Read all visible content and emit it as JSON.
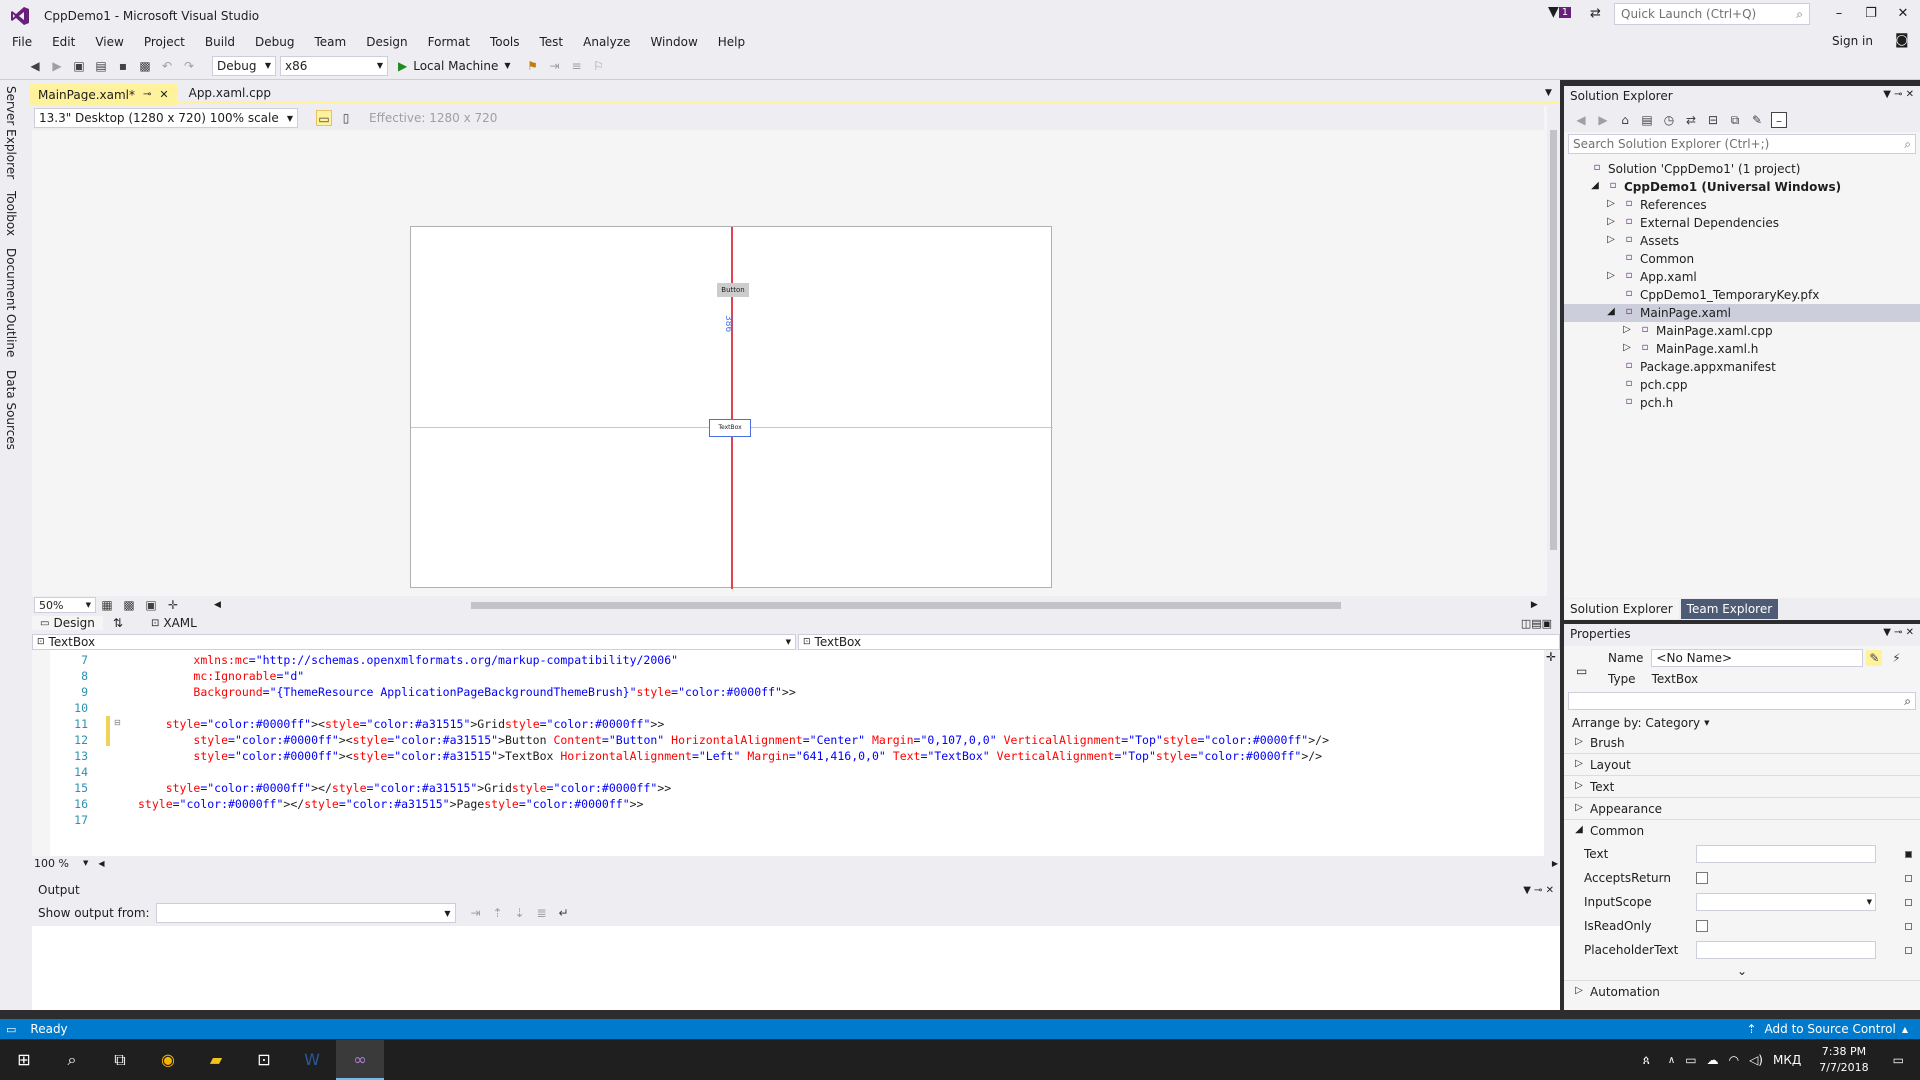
{
  "window": {
    "title": "CppDemo1 - Microsoft Visual Studio",
    "quick_launch_placeholder": "Quick Launch (Ctrl+Q)",
    "notification_count": "1",
    "sign_in": "Sign in"
  },
  "menu": [
    "File",
    "Edit",
    "View",
    "Project",
    "Build",
    "Debug",
    "Team",
    "Design",
    "Format",
    "Tools",
    "Test",
    "Analyze",
    "Window",
    "Help"
  ],
  "toolbar": {
    "config": "Debug",
    "platform": "x86",
    "run_target": "Local Machine"
  },
  "left_tabs": [
    "Server Explorer",
    "Toolbox",
    "Document Outline",
    "Data Sources"
  ],
  "doc_tabs": [
    {
      "label": "MainPage.xaml*",
      "active": true
    },
    {
      "label": "App.xaml.cpp",
      "active": false
    }
  ],
  "designer": {
    "device": "13.3\" Desktop (1280 x 720) 100% scale",
    "effective": "Effective: 1280 x 720",
    "zoom": "50%",
    "button_label": "Button",
    "textbox_label": "TextBox",
    "margin_label": "386",
    "design_tab": "Design",
    "xaml_tab": "XAML",
    "left_element": "TextBox",
    "right_element": "TextBox"
  },
  "code": {
    "zoom": "100 %",
    "lines": [
      {
        "num": "7",
        "text": "        xmlns:mc=\"http://schemas.openxmlformats.org/markup-compatibility/2006\""
      },
      {
        "num": "8",
        "text": "        mc:Ignorable=\"d\""
      },
      {
        "num": "9",
        "text": "        Background=\"{ThemeResource ApplicationPageBackgroundThemeBrush}\">"
      },
      {
        "num": "10",
        "text": ""
      },
      {
        "num": "11",
        "text": "    <Grid>"
      },
      {
        "num": "12",
        "text": "        <Button Content=\"Button\" HorizontalAlignment=\"Center\" Margin=\"0,107,0,0\" VerticalAlignment=\"Top\"/>"
      },
      {
        "num": "13",
        "text": "        <TextBox HorizontalAlignment=\"Left\" Margin=\"641,416,0,0\" Text=\"TextBox\" VerticalAlignment=\"Top\"/>"
      },
      {
        "num": "14",
        "text": ""
      },
      {
        "num": "15",
        "text": "    </Grid>"
      },
      {
        "num": "16",
        "text": "</Page>"
      },
      {
        "num": "17",
        "text": ""
      }
    ]
  },
  "output": {
    "title": "Output",
    "show_from": "Show output from:"
  },
  "solution_explorer": {
    "title": "Solution Explorer",
    "search_placeholder": "Search Solution Explorer (Ctrl+;)",
    "items": [
      {
        "label": "Solution 'CppDemo1' (1 project)",
        "depth": 0,
        "bold": false,
        "expander": "",
        "selected": false
      },
      {
        "label": "CppDemo1 (Universal Windows)",
        "depth": 1,
        "bold": true,
        "expander": "◢",
        "selected": false
      },
      {
        "label": "References",
        "depth": 2,
        "bold": false,
        "expander": "▷",
        "selected": false
      },
      {
        "label": "External Dependencies",
        "depth": 2,
        "bold": false,
        "expander": "▷",
        "selected": false
      },
      {
        "label": "Assets",
        "depth": 2,
        "bold": false,
        "expander": "▷",
        "selected": false
      },
      {
        "label": "Common",
        "depth": 2,
        "bold": false,
        "expander": "",
        "selected": false
      },
      {
        "label": "App.xaml",
        "depth": 2,
        "bold": false,
        "expander": "▷",
        "selected": false
      },
      {
        "label": "CppDemo1_TemporaryKey.pfx",
        "depth": 2,
        "bold": false,
        "expander": "",
        "selected": false
      },
      {
        "label": "MainPage.xaml",
        "depth": 2,
        "bold": false,
        "expander": "◢",
        "selected": true
      },
      {
        "label": "MainPage.xaml.cpp",
        "depth": 3,
        "bold": false,
        "expander": "▷",
        "selected": false
      },
      {
        "label": "MainPage.xaml.h",
        "depth": 3,
        "bold": false,
        "expander": "▷",
        "selected": false
      },
      {
        "label": "Package.appxmanifest",
        "depth": 2,
        "bold": false,
        "expander": "",
        "selected": false
      },
      {
        "label": "pch.cpp",
        "depth": 2,
        "bold": false,
        "expander": "",
        "selected": false
      },
      {
        "label": "pch.h",
        "depth": 2,
        "bold": false,
        "expander": "",
        "selected": false
      }
    ],
    "tab_solution": "Solution Explorer",
    "tab_team": "Team Explorer"
  },
  "properties": {
    "title": "Properties",
    "name_label": "Name",
    "name_value": "<No Name>",
    "type_label": "Type",
    "type_value": "TextBox",
    "arrange_by": "Arrange by: Category",
    "categories": [
      "Brush",
      "Layout",
      "Text",
      "Appearance"
    ],
    "common": "Common",
    "rows": [
      "Text",
      "AcceptsReturn",
      "InputScope",
      "IsReadOnly",
      "PlaceholderText"
    ],
    "automation": "Automation"
  },
  "status": {
    "ready": "Ready",
    "source_control": "Add to Source Control"
  },
  "taskbar": {
    "lang": "МКД",
    "time": "7:38 PM",
    "date": "7/7/2018"
  },
  "colors": {
    "accent": "#007acc",
    "vs_purple": "#68217a",
    "tab_active": "#fff29d"
  }
}
